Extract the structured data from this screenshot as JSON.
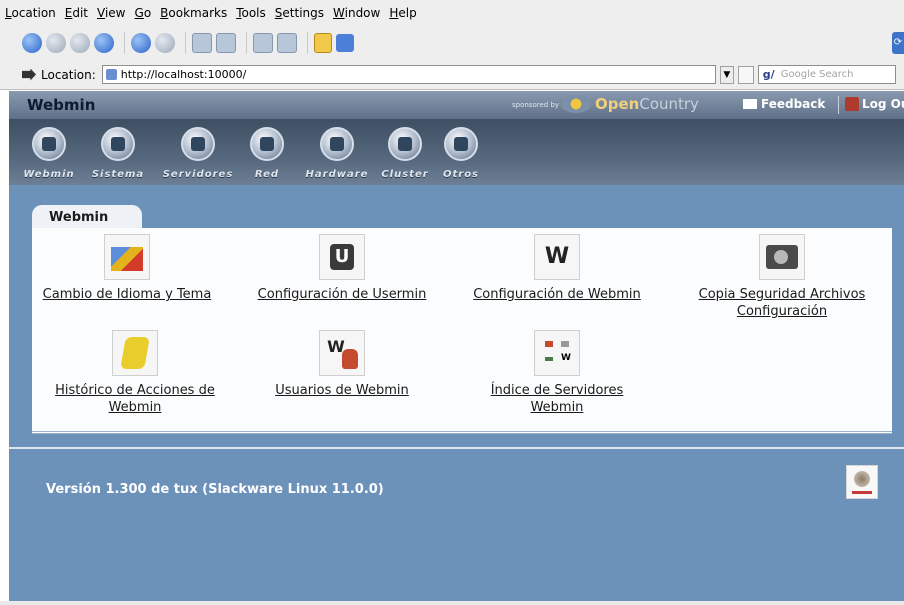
{
  "menu": {
    "items": [
      "Location",
      "Edit",
      "View",
      "Go",
      "Bookmarks",
      "Tools",
      "Settings",
      "Window",
      "Help"
    ]
  },
  "toolbar": {
    "buttons": [
      "back",
      "forward",
      "up",
      "home",
      "reload",
      "stop",
      "print",
      "find",
      "zoom-in",
      "zoom-out",
      "security-lock",
      "download"
    ]
  },
  "location_bar": {
    "label": "Location:",
    "url": "http://localhost:10000/",
    "search_placeholder": "Google Search"
  },
  "header": {
    "title": "Webmin",
    "sponsored_by": "sponsored by",
    "sponsor_name_1": "Open",
    "sponsor_name_2": "Country",
    "feedback": "Feedback",
    "logout": "Log Ou"
  },
  "categories": [
    {
      "label": "Webmin",
      "icon": "webmin-icon"
    },
    {
      "label": "Sistema",
      "icon": "system-icon"
    },
    {
      "label": "Servidores",
      "icon": "servers-icon"
    },
    {
      "label": "Red",
      "icon": "network-icon"
    },
    {
      "label": "Hardware",
      "icon": "hardware-icon"
    },
    {
      "label": "Cluster",
      "icon": "cluster-icon"
    },
    {
      "label": "Otros",
      "icon": "others-icon"
    }
  ],
  "main": {
    "tab": "Webmin",
    "modules": [
      {
        "line1": "Cambio de Idioma y Tema",
        "line2": "",
        "icon": "language-theme-icon"
      },
      {
        "line1": "Configuración de Usermin",
        "line2": "",
        "icon": "usermin-config-icon"
      },
      {
        "line1": "Configuración de Webmin",
        "line2": "",
        "icon": "webmin-config-icon"
      },
      {
        "line1": "Copia Seguridad Archivos",
        "line2": "Configuración",
        "icon": "backup-config-icon"
      },
      {
        "line1": "Histórico de Acciones de",
        "line2": "Webmin",
        "icon": "action-log-icon"
      },
      {
        "line1": "Usuarios de Webmin",
        "line2": "",
        "icon": "webmin-users-icon"
      },
      {
        "line1": "Índice de Servidores",
        "line2": "Webmin",
        "icon": "server-index-icon"
      }
    ],
    "version": "Versión 1.300 de tux (Slackware Linux 11.0.0)"
  }
}
